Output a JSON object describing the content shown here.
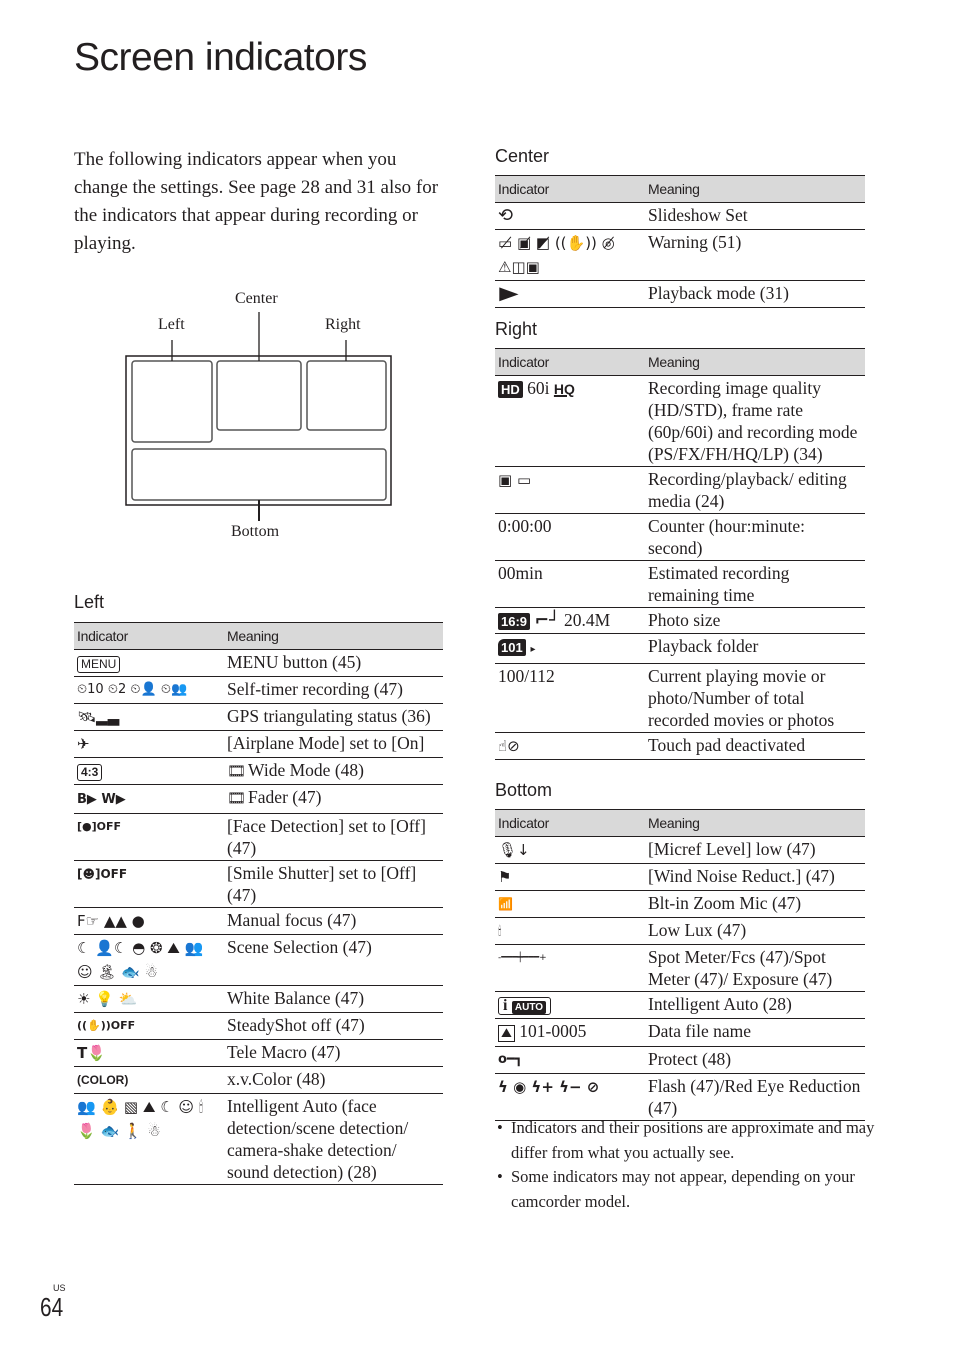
{
  "page": {
    "title": "Screen indicators",
    "intro": "The following indicators appear when you change the settings. See page 28 and 31 also for the indicators that appear during recording or playing.",
    "region": "US",
    "number": "64"
  },
  "diagram": {
    "labels": {
      "left": "Left",
      "center": "Center",
      "right": "Right",
      "bottom": "Bottom"
    }
  },
  "table_headers": {
    "indicator": "Indicator",
    "meaning": "Meaning"
  },
  "sections": {
    "left": {
      "title": "Left",
      "rows": [
        {
          "indicator": "MENU",
          "icon": "menu-button-icon",
          "meaning": "MENU button (45)"
        },
        {
          "indicator": "⏲10 ⏲2 ⏲👤 ⏲👥",
          "icon": "self-timer-icons",
          "meaning": "Self-timer recording (47)"
        },
        {
          "indicator": "🛰▂▃",
          "icon": "gps-signal-icon",
          "meaning": "GPS triangulating status (36)"
        },
        {
          "indicator": "✈",
          "icon": "airplane-icon",
          "meaning": "[Airplane Mode] set to [On]"
        },
        {
          "indicator": "4:3",
          "icon": "aspect-4-3-icon",
          "meaning": "Wide Mode (48)",
          "film": true
        },
        {
          "indicator": "B▶ W▶",
          "icon": "fader-icons",
          "meaning": "Fader (47)",
          "film": true
        },
        {
          "indicator": "[●]OFF",
          "icon": "face-detection-off-icon",
          "meaning": "[Face Detection] set to [Off] (47)"
        },
        {
          "indicator": "[☻]OFF",
          "icon": "smile-shutter-off-icon",
          "meaning": "[Smile Shutter] set to [Off] (47)"
        },
        {
          "indicator": "F☞ ▲▲ ●",
          "icon": "manual-focus-icons",
          "meaning": "Manual focus (47)"
        },
        {
          "indicator": "☾ 👤☾ ◓ ❂ ⛰ 👥 ☺ 🏝 🐟 ☃",
          "icon": "scene-selection-icons",
          "meaning": "Scene Selection (47)"
        },
        {
          "indicator": "☀ 💡 ⛅",
          "icon": "white-balance-icons",
          "meaning": "White Balance (47)"
        },
        {
          "indicator": "((✋))OFF",
          "icon": "steadyshot-off-icon",
          "meaning": "SteadyShot off (47)"
        },
        {
          "indicator": "T🌷",
          "icon": "tele-macro-icon",
          "meaning": "Tele Macro (47)"
        },
        {
          "indicator": "(COLOR)",
          "icon": "xv-color-icon",
          "meaning": "x.v.Color (48)"
        },
        {
          "indicator": "👥 👶 ▧ ⛰ ☾ ☺ 🕯 🌷 🐟 🚶 ☃",
          "icon": "intelligent-auto-icons",
          "meaning": "Intelligent Auto (face detection/scene detection/ camera-shake detection/ sound detection) (28)"
        }
      ]
    },
    "center": {
      "title": "Center",
      "rows": [
        {
          "indicator": "⟲",
          "icon": "slideshow-icon",
          "meaning": "Slideshow Set"
        },
        {
          "indicator": "▭̸ ▣̸ ◩̸ ((✋)) ◎̸ ⚠◫▣",
          "icon": "warning-icons",
          "meaning": "Warning (51)"
        },
        {
          "indicator": "▶",
          "icon": "playback-icon",
          "meaning": "Playback mode (31)"
        }
      ]
    },
    "right": {
      "title": "Right",
      "rows": [
        {
          "indicator_parts": [
            "HD",
            "60i",
            "HQ"
          ],
          "icon": "hd-quality-icon",
          "meaning": "Recording image quality (HD/STD), frame rate (60p/60i) and recording mode (PS/FX/FH/HQ/LP) (34)"
        },
        {
          "indicator": "▣ ▭",
          "icon": "media-icons",
          "meaning": "Recording/playback/ editing media (24)"
        },
        {
          "indicator": "0:00:00",
          "meaning": "Counter (hour:minute: second)",
          "text": true
        },
        {
          "indicator": "00min",
          "meaning": "Estimated recording remaining time",
          "text": true
        },
        {
          "indicator_parts": [
            "16:9",
            "⌐┘",
            "20.4M"
          ],
          "icon": "photo-size-icon",
          "meaning": "Photo size"
        },
        {
          "indicator_parts": [
            "101",
            "▸"
          ],
          "icon": "folder-icon",
          "meaning": "Playback folder"
        },
        {
          "indicator": "100/112",
          "meaning": "Current playing movie or photo/Number of total recorded movies or photos",
          "text": true
        },
        {
          "indicator": "☝⊘",
          "icon": "touch-pad-off-icon",
          "meaning": "Touch pad deactivated"
        }
      ]
    },
    "bottom": {
      "title": "Bottom",
      "rows": [
        {
          "indicator": "🎙↓",
          "icon": "mic-level-low-icon",
          "meaning": "[Micref Level] low (47)"
        },
        {
          "indicator": "⚑",
          "icon": "wind-noise-icon",
          "meaning": "[Wind Noise Reduct.] (47)"
        },
        {
          "indicator": "📶",
          "icon": "zoom-mic-icon",
          "meaning": "Blt-in Zoom Mic (47)"
        },
        {
          "indicator": "🕯",
          "icon": "low-lux-icon",
          "meaning": "Low Lux (47)"
        },
        {
          "indicator": "-━━━┿━━━+",
          "icon": "spot-meter-slider-icon",
          "meaning": "Spot Meter/Fcs (47)/Spot Meter (47)/ Exposure (47)"
        },
        {
          "indicator_parts": [
            "i",
            "AUTO"
          ],
          "icon": "intelligent-auto-icon",
          "meaning": "Intelligent Auto (28)"
        },
        {
          "indicator_parts": [
            "⛰",
            "101-0005"
          ],
          "icon": "data-file-icon",
          "meaning": "Data file name"
        },
        {
          "indicator": "o━┓",
          "icon": "protect-key-icon",
          "meaning": "Protect (48)"
        },
        {
          "indicator": "ϟ ◉ ϟ+ ϟ− ⊘",
          "icon": "flash-icons",
          "meaning": "Flash (47)/Red Eye Reduction (47)"
        }
      ]
    }
  },
  "notes": [
    "Indicators and their positions are approximate and may differ from what you actually see.",
    "Some indicators may not appear, depending on your camcorder model."
  ]
}
